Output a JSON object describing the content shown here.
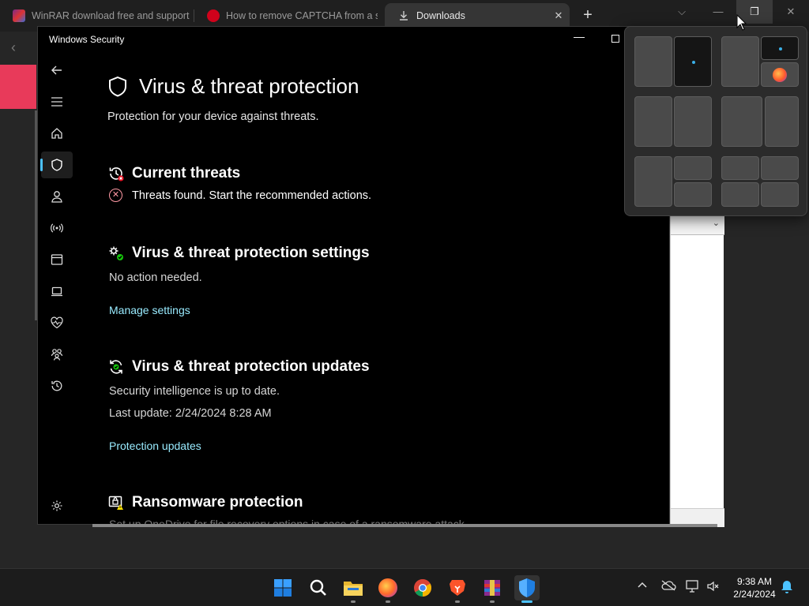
{
  "browser": {
    "tabs": [
      {
        "title": "WinRAR download free and support",
        "active": false
      },
      {
        "title": "How to remove CAPTCHA from a site",
        "active": false
      },
      {
        "title": "Downloads",
        "active": true
      }
    ],
    "new_tab": "+",
    "close_tab": "✕",
    "window_controls": {
      "dropdown": "⌵",
      "minimize": "—",
      "restore": "❐",
      "close": "✕"
    }
  },
  "security": {
    "window_title": "Windows Security",
    "page_title": "Virus & threat protection",
    "page_subtitle": "Protection for your device against threats.",
    "current_threats": {
      "title": "Current threats",
      "status": "Threats found. Start the recommended actions."
    },
    "settings": {
      "title": "Virus & threat protection settings",
      "status": "No action needed.",
      "link": "Manage settings"
    },
    "updates": {
      "title": "Virus & threat protection updates",
      "status": "Security intelligence is up to date.",
      "last_update": "Last update: 2/24/2024 8:28 AM",
      "link": "Protection updates"
    },
    "ransomware": {
      "title": "Ransomware protection",
      "text": "Set up OneDrive for file recovery options in case of a ransomware attack."
    },
    "nav_items": [
      "back-icon",
      "menu-icon",
      "home-icon",
      "shield-icon",
      "account-icon",
      "network-icon",
      "app-browser-icon",
      "device-security-icon",
      "health-icon",
      "family-icon",
      "history-icon",
      "settings-icon"
    ]
  },
  "taskbar": {
    "time": "9:38 AM",
    "date": "2/24/2024",
    "colors": {
      "accent": "#4cc2ff",
      "error": "#ff99a4",
      "link": "#99ebff"
    }
  }
}
